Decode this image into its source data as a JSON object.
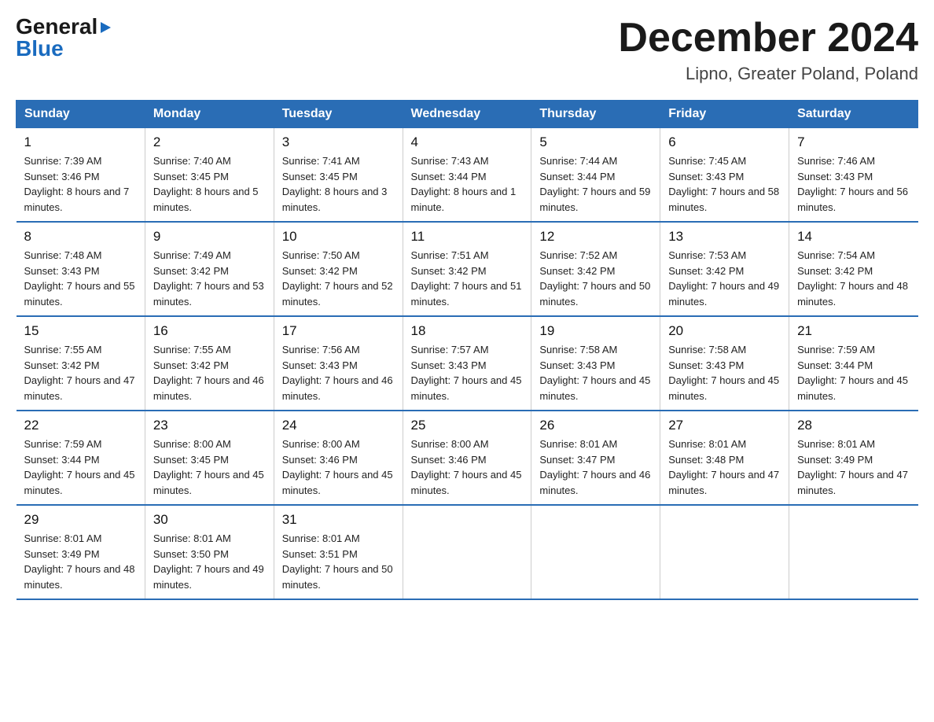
{
  "header": {
    "logo_general": "General",
    "logo_blue": "Blue",
    "month_title": "December 2024",
    "location": "Lipno, Greater Poland, Poland"
  },
  "weekdays": [
    "Sunday",
    "Monday",
    "Tuesday",
    "Wednesday",
    "Thursday",
    "Friday",
    "Saturday"
  ],
  "weeks": [
    [
      {
        "day": "1",
        "sunrise": "7:39 AM",
        "sunset": "3:46 PM",
        "daylight": "8 hours and 7 minutes."
      },
      {
        "day": "2",
        "sunrise": "7:40 AM",
        "sunset": "3:45 PM",
        "daylight": "8 hours and 5 minutes."
      },
      {
        "day": "3",
        "sunrise": "7:41 AM",
        "sunset": "3:45 PM",
        "daylight": "8 hours and 3 minutes."
      },
      {
        "day": "4",
        "sunrise": "7:43 AM",
        "sunset": "3:44 PM",
        "daylight": "8 hours and 1 minute."
      },
      {
        "day": "5",
        "sunrise": "7:44 AM",
        "sunset": "3:44 PM",
        "daylight": "7 hours and 59 minutes."
      },
      {
        "day": "6",
        "sunrise": "7:45 AM",
        "sunset": "3:43 PM",
        "daylight": "7 hours and 58 minutes."
      },
      {
        "day": "7",
        "sunrise": "7:46 AM",
        "sunset": "3:43 PM",
        "daylight": "7 hours and 56 minutes."
      }
    ],
    [
      {
        "day": "8",
        "sunrise": "7:48 AM",
        "sunset": "3:43 PM",
        "daylight": "7 hours and 55 minutes."
      },
      {
        "day": "9",
        "sunrise": "7:49 AM",
        "sunset": "3:42 PM",
        "daylight": "7 hours and 53 minutes."
      },
      {
        "day": "10",
        "sunrise": "7:50 AM",
        "sunset": "3:42 PM",
        "daylight": "7 hours and 52 minutes."
      },
      {
        "day": "11",
        "sunrise": "7:51 AM",
        "sunset": "3:42 PM",
        "daylight": "7 hours and 51 minutes."
      },
      {
        "day": "12",
        "sunrise": "7:52 AM",
        "sunset": "3:42 PM",
        "daylight": "7 hours and 50 minutes."
      },
      {
        "day": "13",
        "sunrise": "7:53 AM",
        "sunset": "3:42 PM",
        "daylight": "7 hours and 49 minutes."
      },
      {
        "day": "14",
        "sunrise": "7:54 AM",
        "sunset": "3:42 PM",
        "daylight": "7 hours and 48 minutes."
      }
    ],
    [
      {
        "day": "15",
        "sunrise": "7:55 AM",
        "sunset": "3:42 PM",
        "daylight": "7 hours and 47 minutes."
      },
      {
        "day": "16",
        "sunrise": "7:55 AM",
        "sunset": "3:42 PM",
        "daylight": "7 hours and 46 minutes."
      },
      {
        "day": "17",
        "sunrise": "7:56 AM",
        "sunset": "3:43 PM",
        "daylight": "7 hours and 46 minutes."
      },
      {
        "day": "18",
        "sunrise": "7:57 AM",
        "sunset": "3:43 PM",
        "daylight": "7 hours and 45 minutes."
      },
      {
        "day": "19",
        "sunrise": "7:58 AM",
        "sunset": "3:43 PM",
        "daylight": "7 hours and 45 minutes."
      },
      {
        "day": "20",
        "sunrise": "7:58 AM",
        "sunset": "3:43 PM",
        "daylight": "7 hours and 45 minutes."
      },
      {
        "day": "21",
        "sunrise": "7:59 AM",
        "sunset": "3:44 PM",
        "daylight": "7 hours and 45 minutes."
      }
    ],
    [
      {
        "day": "22",
        "sunrise": "7:59 AM",
        "sunset": "3:44 PM",
        "daylight": "7 hours and 45 minutes."
      },
      {
        "day": "23",
        "sunrise": "8:00 AM",
        "sunset": "3:45 PM",
        "daylight": "7 hours and 45 minutes."
      },
      {
        "day": "24",
        "sunrise": "8:00 AM",
        "sunset": "3:46 PM",
        "daylight": "7 hours and 45 minutes."
      },
      {
        "day": "25",
        "sunrise": "8:00 AM",
        "sunset": "3:46 PM",
        "daylight": "7 hours and 45 minutes."
      },
      {
        "day": "26",
        "sunrise": "8:01 AM",
        "sunset": "3:47 PM",
        "daylight": "7 hours and 46 minutes."
      },
      {
        "day": "27",
        "sunrise": "8:01 AM",
        "sunset": "3:48 PM",
        "daylight": "7 hours and 47 minutes."
      },
      {
        "day": "28",
        "sunrise": "8:01 AM",
        "sunset": "3:49 PM",
        "daylight": "7 hours and 47 minutes."
      }
    ],
    [
      {
        "day": "29",
        "sunrise": "8:01 AM",
        "sunset": "3:49 PM",
        "daylight": "7 hours and 48 minutes."
      },
      {
        "day": "30",
        "sunrise": "8:01 AM",
        "sunset": "3:50 PM",
        "daylight": "7 hours and 49 minutes."
      },
      {
        "day": "31",
        "sunrise": "8:01 AM",
        "sunset": "3:51 PM",
        "daylight": "7 hours and 50 minutes."
      },
      null,
      null,
      null,
      null
    ]
  ],
  "labels": {
    "sunrise": "Sunrise:",
    "sunset": "Sunset:",
    "daylight": "Daylight:"
  }
}
